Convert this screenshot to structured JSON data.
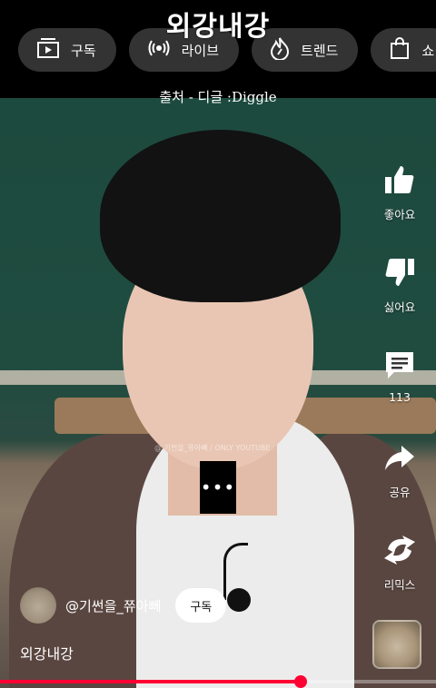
{
  "watermark": {
    "channel_title": "외강내강",
    "credit": "출처 - 디글 :Diggle",
    "overlay_small": "@ 기썬을_쮸아뻬 / ONLY YOUTUBE"
  },
  "top_chips": [
    {
      "label": "구독",
      "icon": "subscriptions-icon"
    },
    {
      "label": "라이브",
      "icon": "live-icon"
    },
    {
      "label": "트렌드",
      "icon": "trending-icon"
    },
    {
      "label": "쇼",
      "icon": "shopping-bag-icon"
    }
  ],
  "actions": [
    {
      "label": "좋아요",
      "icon": "thumbs-up-icon"
    },
    {
      "label": "싫어요",
      "icon": "thumbs-down-icon"
    },
    {
      "label": "113",
      "icon": "comment-icon"
    },
    {
      "label": "공유",
      "icon": "share-icon"
    },
    {
      "label": "리믹스",
      "icon": "remix-icon"
    }
  ],
  "center_overlay": {
    "label": "•••"
  },
  "channel": {
    "handle": "@기썬을_쮸아뻬",
    "subscribe_label": "구독"
  },
  "video": {
    "title": "외강내강"
  },
  "progress": {
    "fraction": 0.69
  },
  "colors": {
    "accent": "#ff0033",
    "chip_bg": "#3c3c3c"
  }
}
